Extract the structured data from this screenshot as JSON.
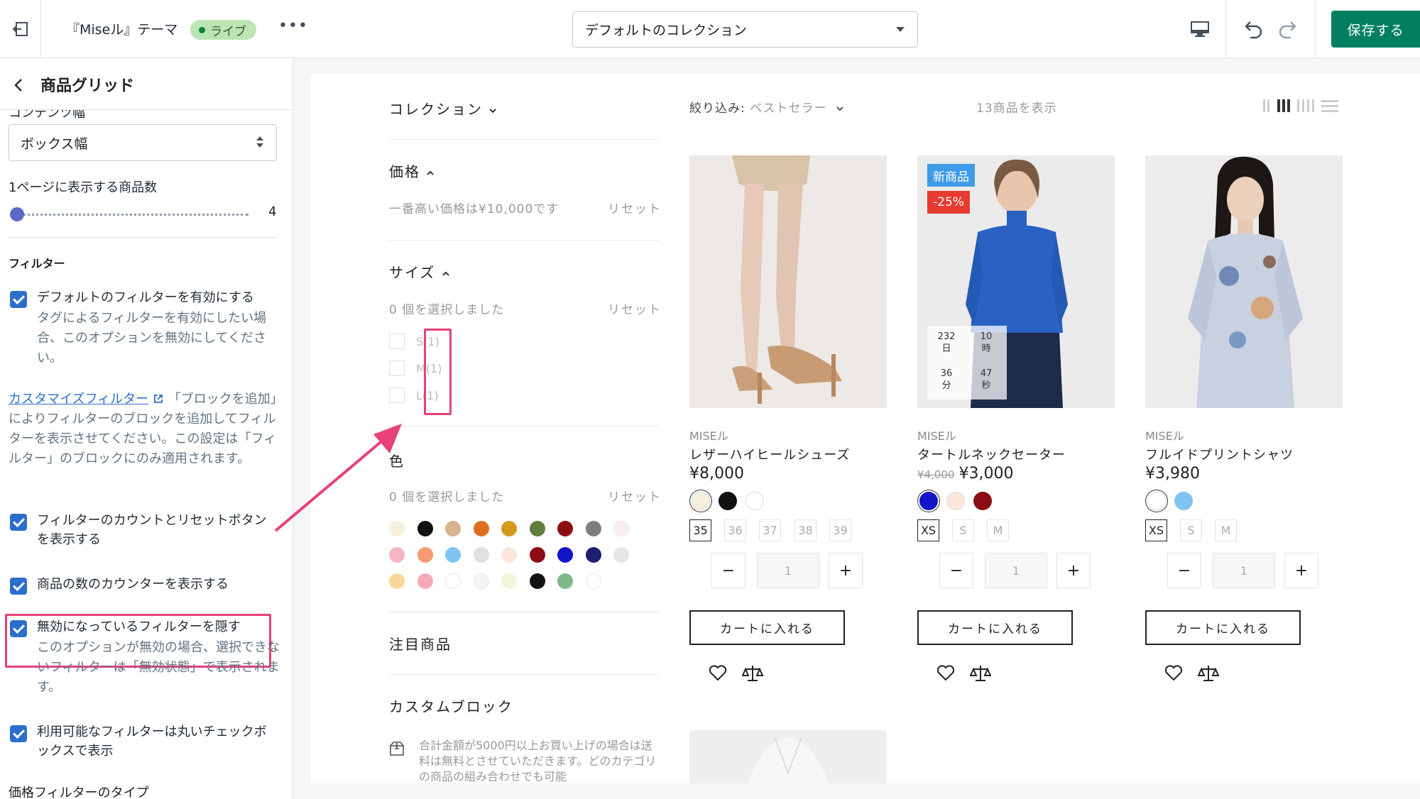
{
  "topbar": {
    "theme_title": "『Miseル』テーマ",
    "live_badge": "ライブ",
    "more": "•••",
    "collection_select": "デフォルトのコレクション",
    "save_label": "保存する"
  },
  "sidebar": {
    "title": "商品グリッド",
    "cut_label": "コンテンツ幅",
    "width_select": "ボックス幅",
    "per_page_label": "1ページに表示する商品数",
    "per_page_value": "4",
    "filter_heading": "フィルター",
    "opt1_label": "デフォルトのフィルターを有効にする",
    "opt1_help": "タグによるフィルターを有効にしたい場合、このオプションを無効にしてください。",
    "custom_link": "カスタマイズフィルター",
    "custom_para": "「ブロックを追加」によりフィルターのブロックを追加してフィルターを表示させてください。この設定は「フィルター」のブロックにのみ適用されます。",
    "opt2_label": "フィルターのカウントとリセットボタンを表示する",
    "opt3_label": "商品の数のカウンターを表示する",
    "opt4_label": "無効になっているフィルターを隠す",
    "opt4_help": "このオプションが無効の場合、選択できないフィルターは「無効状態」で表示されます。",
    "opt5_label": "利用可能なフィルターは丸いチェックボックスで表示",
    "price_type_label": "価格フィルターのタイプ"
  },
  "filters": {
    "collection": "コレクション",
    "price_title": "価格",
    "price_info": "一番高い価格は¥10,000です",
    "reset": "リセット",
    "size_title": "サイズ",
    "selected_none": "0 個を選択しました",
    "sizes": [
      {
        "label": "S",
        "count": "(1)"
      },
      {
        "label": "M",
        "count": "(1)"
      },
      {
        "label": "L",
        "count": "(1)"
      }
    ],
    "color_title": "色",
    "colors": [
      [
        "#f5f1dd",
        "#111111",
        "#d8b48c",
        "#dd6e1f",
        "#d49a1c",
        "#5f7d3c",
        "#8b0f12",
        "#7d7d7d",
        "#fbeef0"
      ],
      [
        "#f5b6c2",
        "#f59a73",
        "#7fc4f3",
        "#e0e0e0",
        "#fbe6dc",
        "#8b0c12",
        "#1414c8",
        "#1d1f72",
        "#e6e6e6"
      ],
      [
        "#fbd79b",
        "#f5a9b8",
        "#ffffff",
        "#f5f5f5",
        "#f4f4dc",
        "#111111",
        "#7fb88a",
        "#ffffff"
      ]
    ],
    "featured_title": "注目商品",
    "custom_block_title": "カスタムブロック",
    "promo": "合計金額が5000円以上お買い上げの場合は送料は無料とさせていただきます。どのカテゴリの商品の組み合わせでも可能"
  },
  "toolbar": {
    "sort_prefix": "絞り込み:",
    "sort_value": "ベストセラー",
    "count": "13商品を表示"
  },
  "products": [
    {
      "vendor": "MISEル",
      "name": "レザーハイヒールシューズ",
      "price": "¥8,000",
      "old_price": "",
      "swatches": [
        "#f5f1dd",
        "#111111",
        "#ffffff"
      ],
      "sizes": [
        "35",
        "36",
        "37",
        "38",
        "39"
      ],
      "qty": "1",
      "cart": "カートに入れる"
    },
    {
      "vendor": "MISEル",
      "name": "タートルネックセーター",
      "price": "¥3,000",
      "old_price": "¥4,000",
      "badge_new": "新商品",
      "badge_sale": "-25%",
      "timer": [
        {
          "num": "232",
          "unit": "日"
        },
        {
          "num": "10",
          "unit": "時"
        },
        {
          "num": "36",
          "unit": "分"
        },
        {
          "num": "47",
          "unit": "秒"
        }
      ],
      "swatches": [
        "#1414c8",
        "#fbe6dc",
        "#8b0c12"
      ],
      "sizes": [
        "XS",
        "S",
        "M"
      ],
      "qty": "1",
      "cart": "カートに入れる"
    },
    {
      "vendor": "MISEル",
      "name": "フルイドプリントシャツ",
      "price": "¥3,980",
      "old_price": "",
      "swatches": [
        "#ffffff",
        "#7fc4f3"
      ],
      "sizes": [
        "XS",
        "S",
        "M"
      ],
      "qty": "1",
      "cart": "カートに入れる"
    }
  ],
  "colors": {
    "accent": "#008060",
    "checkbox": "#2c6ecb",
    "annotation": "#e8407a",
    "badge_new": "#3d9be9",
    "badge_sale": "#e63b2e"
  },
  "icons": {
    "exit": "exit-icon",
    "device": "desktop-icon",
    "undo": "undo-icon",
    "redo": "redo-icon",
    "wishlist": "heart-icon",
    "compare": "scale-icon"
  }
}
